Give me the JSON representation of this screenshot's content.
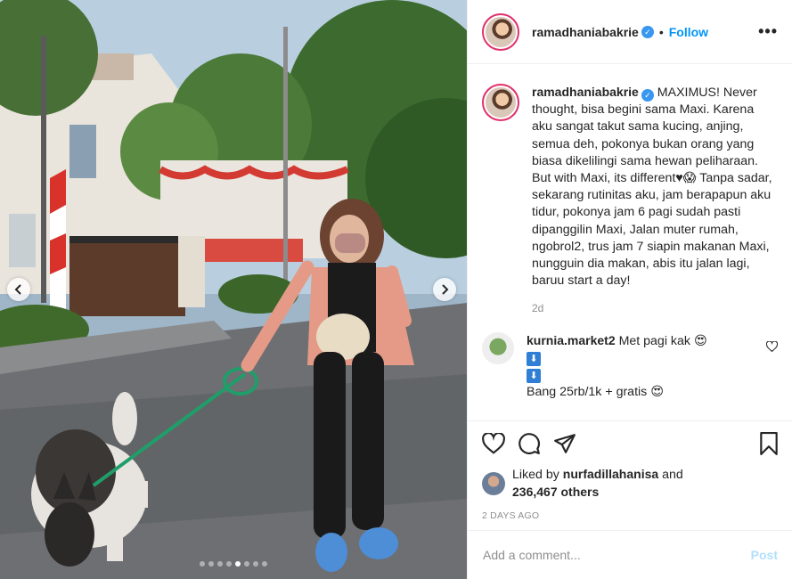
{
  "post": {
    "username": "ramadhaniabakrie",
    "verified_mark": "✓",
    "follow_label": "Follow",
    "more_label": "•••",
    "caption": "MAXIMUS! Never thought, bisa begini sama Maxi. Karena aku sangat takut sama kucing, anjing, semua deh, pokonya bukan orang yang biasa dikelilingi sama hewan peliharaan. But with Maxi, its different♥😱 Tanpa sadar, sekarang rutinitas aku, jam berapapun aku tidur, pokonya jam 6 pagi sudah pasti dipanggilin Maxi, Jalan muter rumah, ngobrol2, trus jam 7 siapin makanan Maxi, nungguin dia makan, abis itu jalan lagi, baruu start a day!",
    "caption_age": "2d",
    "date": "2 DAYS AGO",
    "carousel": {
      "total": 8,
      "active_index": 4
    }
  },
  "comments": [
    {
      "username": "kurnia.market2",
      "text": "Met pagi kak 😍",
      "arrows": [
        "⬇",
        "⬇"
      ],
      "cutoff_line": "Bang 25rb/1k + gratis 😍"
    }
  ],
  "likes": {
    "prefix": "Liked by",
    "user": "nurfadillahanisa",
    "and": "and",
    "others": "236,467 others"
  },
  "composer": {
    "placeholder": "Add a comment...",
    "post_label": "Post"
  },
  "icons": {
    "like": "heart-icon",
    "comment": "comment-icon",
    "share": "share-icon",
    "save": "bookmark-icon",
    "prev": "chevron-left-icon",
    "next": "chevron-right-icon"
  },
  "colors": {
    "accent": "#0095f6",
    "verified": "#3897f0",
    "post_disabled": "#b2dffc"
  }
}
